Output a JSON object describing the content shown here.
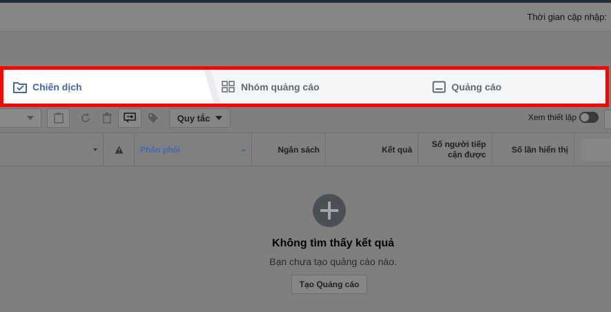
{
  "header": {
    "update_label": "Thời gian cập nhập:"
  },
  "tabs": [
    {
      "label": "Chiến dịch",
      "icon": "folder-check-icon",
      "active": true
    },
    {
      "label": "Nhóm quảng cáo",
      "icon": "grid-icon",
      "active": false
    },
    {
      "label": "Quảng cáo",
      "icon": "ad-icon",
      "active": false
    }
  ],
  "toolbar": {
    "rules_label": "Quy tắc",
    "settings_label": "Xem thiết lập"
  },
  "table": {
    "columns": [
      "Phân phối",
      "Ngân sách",
      "Kết quả",
      "Số người tiếp cận được",
      "Số lần hiển thị"
    ],
    "sorted_column": "Phân phối"
  },
  "empty_state": {
    "title": "Không tìm thấy kết quả",
    "subtitle": "Bạn chưa tạo quảng cáo nào.",
    "button_label": "Tạo Quảng cáo"
  },
  "colors": {
    "highlight_border": "#ff0000",
    "accent": "#4267b2"
  }
}
